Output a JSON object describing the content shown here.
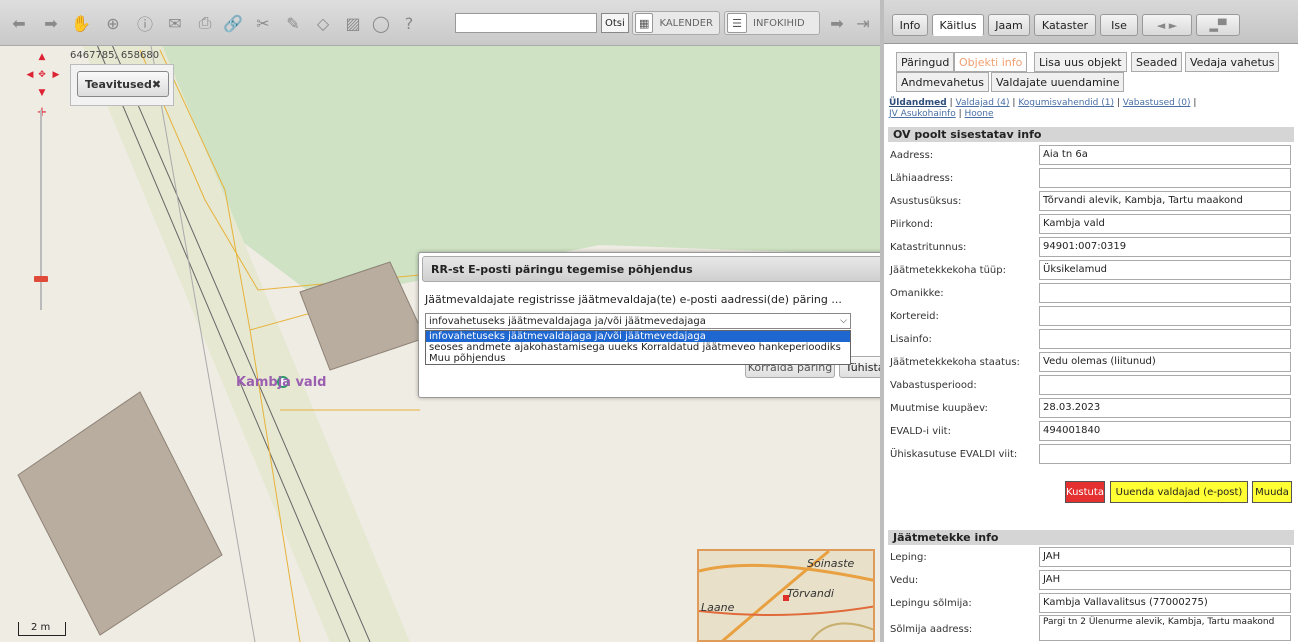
{
  "toolbar": {
    "icons": [
      "back-arrow-icon",
      "forward-arrow-icon",
      "hand-pan-icon",
      "zoom-in-icon",
      "info-icon",
      "mail-icon",
      "print-icon",
      "link-icon",
      "measure-icon",
      "draw-icon",
      "eraser-icon",
      "image-icon",
      "refresh-icon",
      "help-icon"
    ],
    "search_value": "",
    "search_button": "Otsi",
    "calendar_label": "KALENDER",
    "infokihid_label": "INFOKIHID"
  },
  "map": {
    "coords": "6467785, 658680",
    "notifications_label": "Teavitused",
    "place_label": "Kambja vald",
    "scale_label": "2 m",
    "minimap_labels": [
      "Soinaste",
      "Tõrvandi",
      "Laane"
    ]
  },
  "dialog": {
    "title": "RR-st E-posti päringu tegemise põhjendus",
    "message": "Jäätmevaldajate registrisse jäätmevaldaja(te) e-posti aadressi(de) päring ...",
    "selected": "infovahetuseks jäätmevaldajaga ja/või jäätmevedajaga",
    "options": [
      "infovahetuseks jäätmevaldajaga ja/või jäätmevedajaga",
      "seoses andmete ajakohastamisega uueks Korraldatud jäätmeveo hankeperioodiks",
      "Muu põhjendus"
    ],
    "send_button": "Korralda päring",
    "cancel_button": "Tühista"
  },
  "panel": {
    "main_tabs": [
      "Info",
      "Käitlus",
      "Jaam",
      "Kataster",
      "Ise"
    ],
    "active_main_tab": "Käitlus",
    "sub_tabs": [
      "Päringud",
      "Objekti info",
      "Lisa uus objekt",
      "Seaded",
      "Vedaja vahetus",
      "Andmevahetus",
      "Valdajate uuendamine"
    ],
    "active_sub_tab": "Objekti info",
    "links": [
      "Üldandmed",
      "Valdajad (4)",
      "Kogumisvahendid (1)",
      "Vabastused (0)",
      "JV Asukohainfo",
      "Hoone"
    ],
    "section1_title": "OV poolt sisestatav info",
    "fields": [
      {
        "label": "Aadress:",
        "value": "Aia tn 6a"
      },
      {
        "label": "Lähiaadress:",
        "value": ""
      },
      {
        "label": "Asustusüksus:",
        "value": "Tõrvandi alevik, Kambja, Tartu maakond"
      },
      {
        "label": "Piirkond:",
        "value": "Kambja vald"
      },
      {
        "label": "Katastritunnus:",
        "value": "94901:007:0319"
      },
      {
        "label": "Jäätmetekkekoha tüüp:",
        "value": "Üksikelamud"
      },
      {
        "label": "Omanikke:",
        "value": ""
      },
      {
        "label": "Kortereid:",
        "value": ""
      },
      {
        "label": "Lisainfo:",
        "value": ""
      },
      {
        "label": "Jäätmetekkekoha staatus:",
        "value": "Vedu olemas (liitunud)"
      },
      {
        "label": "Vabastusperiood:",
        "value": ""
      },
      {
        "label": "Muutmise kuupäev:",
        "value": "28.03.2023"
      },
      {
        "label": "EVALD-i viit:",
        "value": "494001840"
      },
      {
        "label": "Ühiskasutuse EVALDI viit:",
        "value": ""
      }
    ],
    "buttons": {
      "delete": "Kustuta",
      "update_holders": "Uuenda valdajad (e-post)",
      "edit": "Muuda"
    },
    "section2_title": "Jäätmetekke info",
    "fields2": [
      {
        "label": "Leping:",
        "value": "JAH"
      },
      {
        "label": "Vedu:",
        "value": "JAH"
      },
      {
        "label": "Lepingu sõlmija:",
        "value": "Kambja Vallavalitsus (77000275)"
      },
      {
        "label": "Sõlmija aadress:",
        "value": "Pargi tn 2 Ülenurme alevik, Kambja, Tartu maakond"
      }
    ]
  },
  "colors": {
    "accent": "#e06a00",
    "selected_option": "#1e66d0",
    "delete_button": "#e53030",
    "update_button": "#ffff33",
    "active_subtab_text": "#f0a070",
    "place_label": "#9b5fb0"
  }
}
